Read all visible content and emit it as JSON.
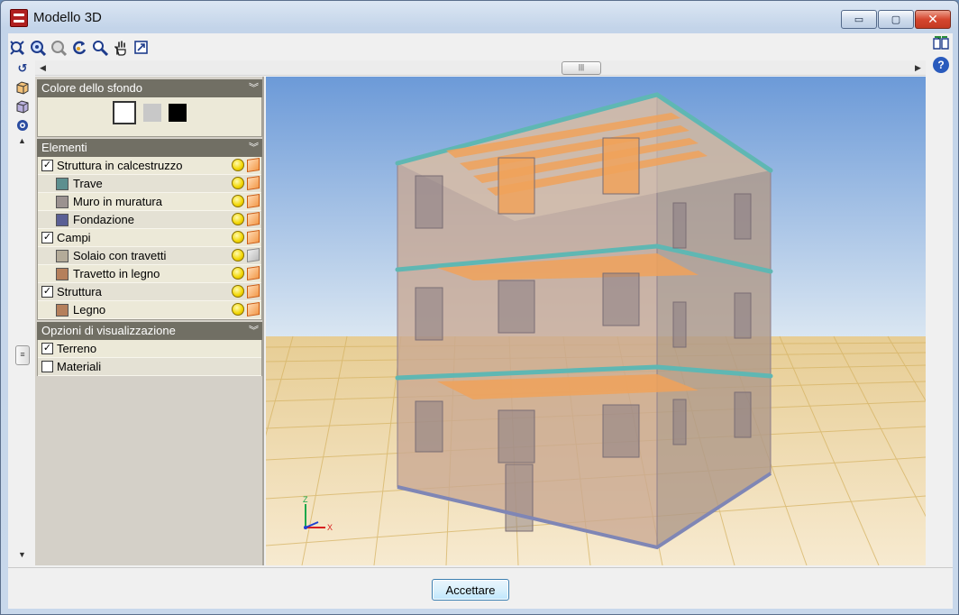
{
  "window": {
    "title": "Modello 3D",
    "minimize_glyph": "▭",
    "maximize_glyph": "▢",
    "close_glyph": "✕"
  },
  "toolbar": {
    "icons": [
      "zoom-extents-icon",
      "zoom-window-icon",
      "zoom-previous-icon",
      "rotate-icon",
      "zoom-icon",
      "pan-hand-icon",
      "export-view-icon"
    ],
    "left_icons": [
      "redo-rotate-icon",
      "solid-view-icon",
      "wireframe-view-icon",
      "render-options-icon"
    ],
    "right_icons": [
      "book-icon",
      "help-icon"
    ]
  },
  "panel": {
    "sections": {
      "background": {
        "title": "Colore dello sfondo",
        "swatches": [
          "#ffffff",
          "#c8c8c8",
          "#000000"
        ]
      },
      "elements": {
        "title": "Elementi",
        "rows": [
          {
            "label": "Struttura in calcestruzzo",
            "type": "group",
            "checked": true
          },
          {
            "label": "Trave",
            "type": "item",
            "color": "#5d8f8f"
          },
          {
            "label": "Muro in muratura",
            "type": "item",
            "color": "#9b9290"
          },
          {
            "label": "Fondazione",
            "type": "item",
            "color": "#5a5f95"
          },
          {
            "label": "Campi",
            "type": "group",
            "checked": true
          },
          {
            "label": "Solaio con travetti",
            "type": "item",
            "color": "#b4ab99"
          },
          {
            "label": "Travetto in legno",
            "type": "item",
            "color": "#b5805c"
          },
          {
            "label": "Struttura",
            "type": "group",
            "checked": true
          },
          {
            "label": "Legno",
            "type": "item",
            "color": "#b5805c"
          }
        ]
      },
      "options": {
        "title": "Opzioni di visualizzazione",
        "rows": [
          {
            "label": "Terreno",
            "checked": true
          },
          {
            "label": "Materiali",
            "checked": false
          }
        ]
      }
    }
  },
  "axes": {
    "x_label": "X",
    "z_label": "Z"
  },
  "colors": {
    "sky_top": "#6c9ad8",
    "sky_bottom": "#dbe7f2",
    "ground": "#f4e4c4",
    "ground_grid": "#d9b96a",
    "wall": "#c9a892",
    "slab_edge": "#5fb7b3",
    "joist": "#f0a25a"
  },
  "footer": {
    "accept_label": "Accettare"
  }
}
